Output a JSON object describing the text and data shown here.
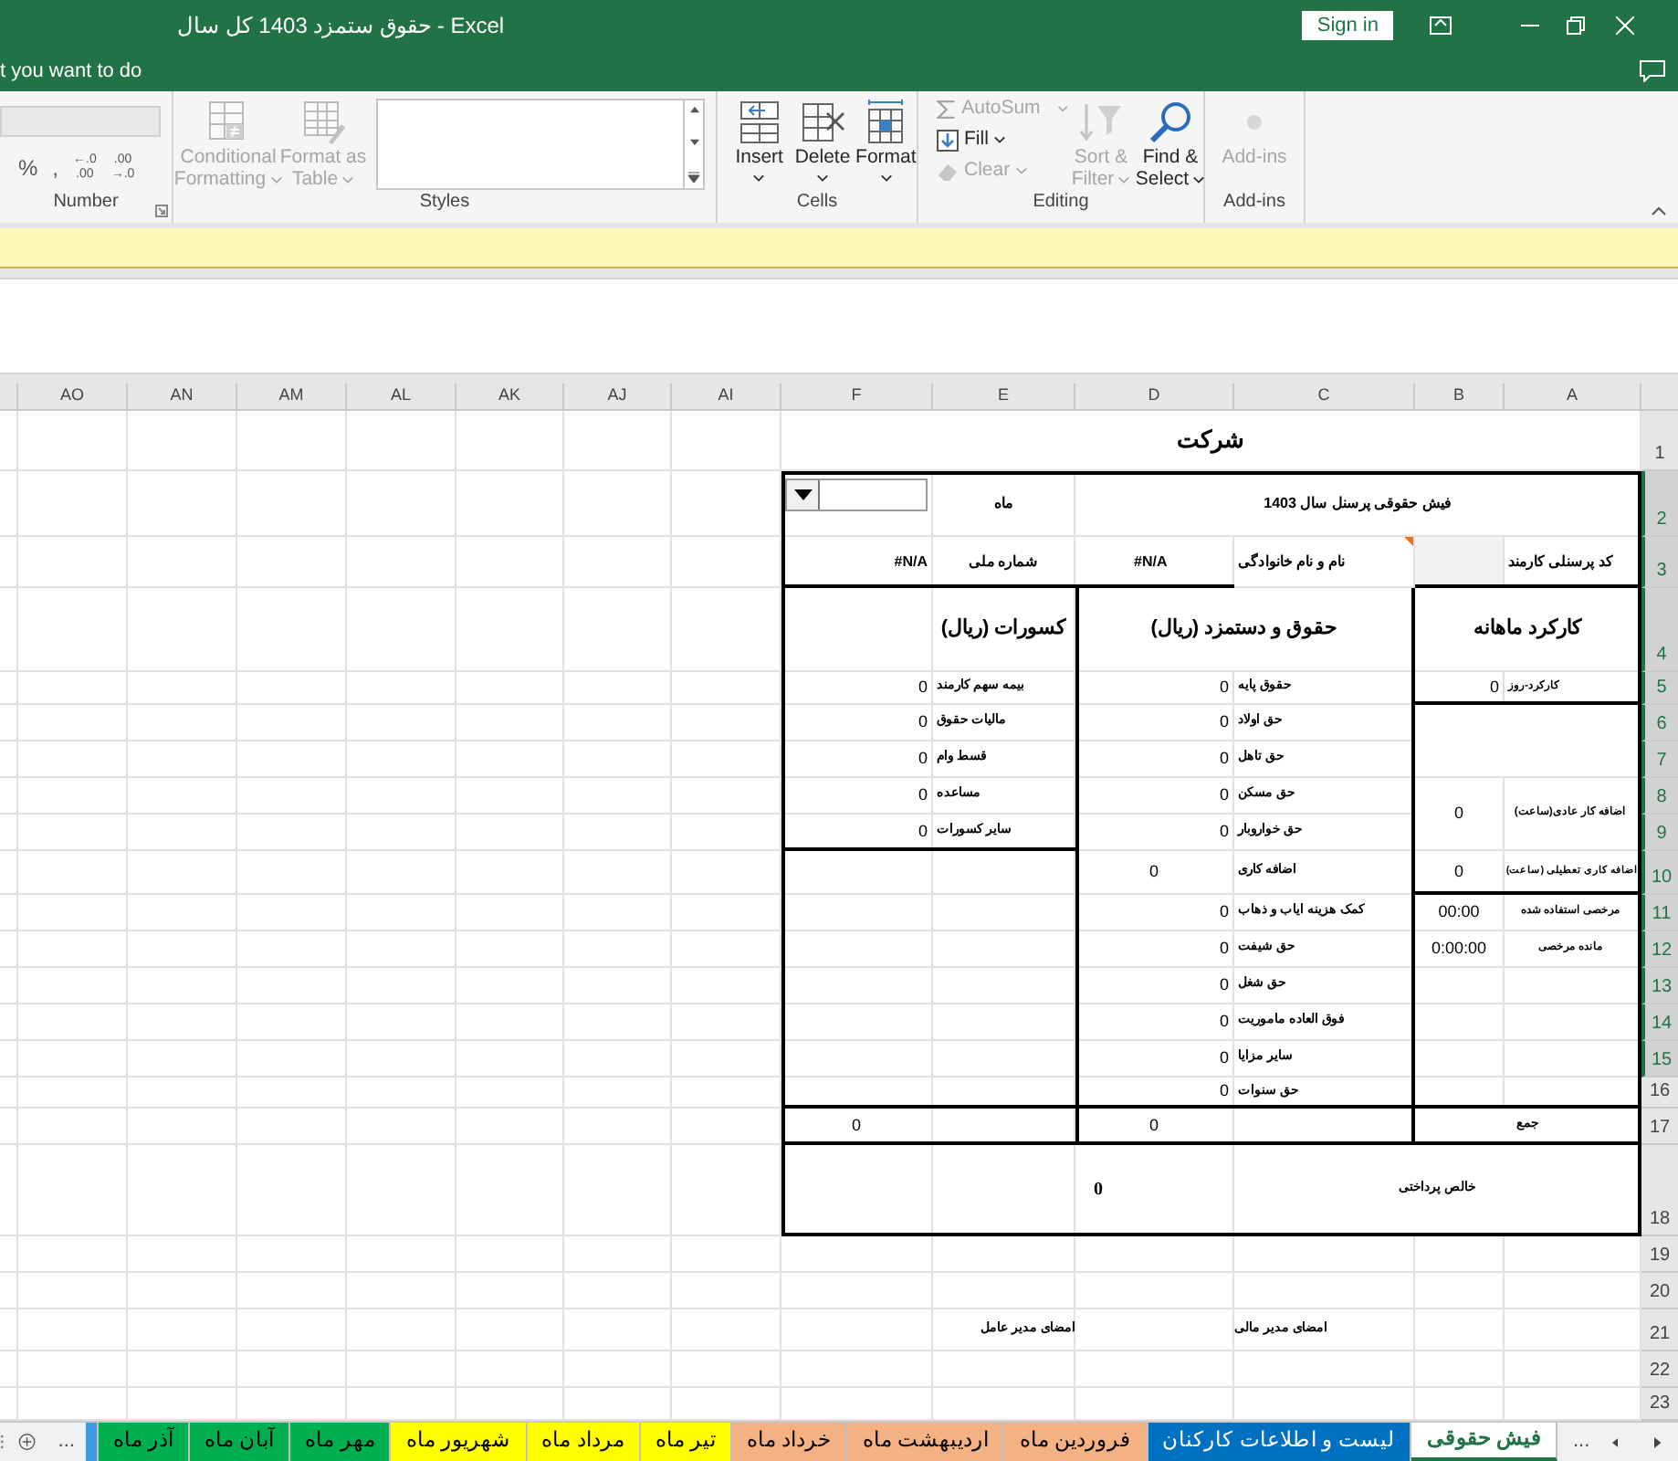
{
  "window": {
    "title": "حقوق  ستمزد 1403 کل سال  -  Excel",
    "sign_in": "Sign in"
  },
  "tell_me": {
    "text": "t you want to do"
  },
  "ribbon": {
    "number": {
      "label": "Number",
      "symbols": [
        ",",
        "%"
      ],
      "decimals": [
        {
          "top": ".00",
          "bottom": "→.0"
        },
        {
          "top": "←.0",
          "bottom": ".00"
        }
      ]
    },
    "styles": {
      "label": "Styles",
      "commands": [
        {
          "lines": [
            "Format as",
            "Table"
          ],
          "disabled": true
        },
        {
          "lines": [
            "Conditional",
            "Formatting"
          ],
          "disabled": true
        }
      ]
    },
    "cells": {
      "label": "Cells",
      "commands": [
        {
          "label": "Format",
          "disabled": false
        },
        {
          "label": "Delete",
          "disabled": false
        },
        {
          "label": "Insert",
          "disabled": false
        }
      ]
    },
    "editing": {
      "label": "Editing",
      "small": [
        {
          "label": "AutoSum",
          "disabled": true
        },
        {
          "label": "Fill",
          "disabled": false
        },
        {
          "label": "Clear",
          "disabled": true
        }
      ],
      "large": [
        {
          "lines": [
            "Find &",
            "Select"
          ],
          "disabled": false
        },
        {
          "lines": [
            "Sort &",
            "Filter"
          ],
          "disabled": true
        }
      ]
    },
    "addins": {
      "label": "Add-ins",
      "commands": [
        {
          "label": "Add-ins",
          "disabled": true
        }
      ]
    }
  },
  "columns": [
    "A",
    "B",
    "C",
    "D",
    "E",
    "F",
    "AI",
    "AJ",
    "AK",
    "AL",
    "AM",
    "AN",
    "AO"
  ],
  "rows": [
    {
      "number": "1",
      "selected": false
    },
    {
      "number": "2",
      "selected": true
    },
    {
      "number": "3",
      "selected": true
    },
    {
      "number": "4",
      "selected": true
    },
    {
      "number": "5",
      "selected": true
    },
    {
      "number": "6",
      "selected": true
    },
    {
      "number": "7",
      "selected": true
    },
    {
      "number": "8",
      "selected": true
    },
    {
      "number": "9",
      "selected": true
    },
    {
      "number": "10",
      "selected": true
    },
    {
      "number": "11",
      "selected": true
    },
    {
      "number": "12",
      "selected": true
    },
    {
      "number": "13",
      "selected": true
    },
    {
      "number": "14",
      "selected": true
    },
    {
      "number": "15",
      "selected": true
    },
    {
      "number": "16",
      "selected": false
    },
    {
      "number": "17",
      "selected": false
    },
    {
      "number": "18",
      "selected": false
    },
    {
      "number": "19",
      "selected": false
    },
    {
      "number": "20",
      "selected": false
    },
    {
      "number": "21",
      "selected": false
    },
    {
      "number": "22",
      "selected": false
    },
    {
      "number": "23",
      "selected": false
    }
  ],
  "payslip": {
    "company": "شرکت",
    "title": "فیش حقوقی  پرسنل سال 1403",
    "month_label": "ماه",
    "employee_code_label": "کد پرسنلی کارمند",
    "name_label": "نام و نام خانوادگی",
    "name_value": "#N/A",
    "national_id_label": "شماره ملی",
    "national_id_value": "#N/A",
    "sections": [
      "کارکرد ماهانه",
      "حقوق و دستمزد (ریال)",
      "کسورات (ریال)"
    ],
    "attendance": [
      {
        "label": "کارکرد-روز",
        "value": "0"
      },
      {
        "label": "اضافه کار عادی(ساعت)",
        "value": "0"
      },
      {
        "label": "اضافه کاری تعطیلی (ساعت)",
        "value": "0"
      },
      {
        "label": "مرخصی استفاده شده",
        "value": "00:00"
      },
      {
        "label": "مانده مرخصی",
        "value": "0:00:00"
      }
    ],
    "earnings": [
      {
        "label": "حقوق پایه",
        "value": "0"
      },
      {
        "label": "حق اولاد",
        "value": "0"
      },
      {
        "label": "حق تاهل",
        "value": "0"
      },
      {
        "label": "حق مسکن",
        "value": "0"
      },
      {
        "label": "حق خواروبار",
        "value": "0"
      },
      {
        "label": "اضافه کاری",
        "value": "0"
      },
      {
        "label": "کمک هزینه ایاب و ذهاب",
        "value": "0"
      },
      {
        "label": "حق شیفت",
        "value": "0"
      },
      {
        "label": "حق شغل",
        "value": "0"
      },
      {
        "label": "فوق العاده ماموریت",
        "value": "0"
      },
      {
        "label": "سایر مزایا",
        "value": "0"
      },
      {
        "label": "حق سنوات",
        "value": "0"
      }
    ],
    "deductions": [
      {
        "label": "بیمه سهم کارمند",
        "value": "0"
      },
      {
        "label": "مالیات حقوق",
        "value": "0"
      },
      {
        "label": "قسط وام",
        "value": "0"
      },
      {
        "label": "مساعده",
        "value": "0"
      },
      {
        "label": "سایر کسورات",
        "value": "0"
      }
    ],
    "total_label": "جمع",
    "earnings_total": "0",
    "deductions_total": "0",
    "net_label": "خالص پرداختی",
    "net_value": "0"
  },
  "signatures": [
    "امضای مدیر مالی",
    "امضای مدیر عامل"
  ],
  "tabs_bar": {
    "more_right": "...",
    "more_left": "..."
  },
  "sheet_tabs": [
    {
      "label": "فیش حقوقی",
      "selected": true
    },
    {
      "label": "لیست و اطلاعات  کارکنان",
      "selected": false,
      "color": "#0070c0"
    },
    {
      "label": "فروردین ماه",
      "selected": false,
      "color": "#f4b183"
    },
    {
      "label": "اردیبهشت ماه",
      "selected": false,
      "color": "#f4b183"
    },
    {
      "label": "خرداد ماه",
      "selected": false,
      "color": "#f4b183"
    },
    {
      "label": "تیر ماه",
      "selected": false,
      "color": "#ffff00"
    },
    {
      "label": "مرداد ماه",
      "selected": false,
      "color": "#ffff00"
    },
    {
      "label": "شهریور ماه",
      "selected": false,
      "color": "#ffff00"
    },
    {
      "label": "مهر ماه",
      "selected": false,
      "color": "#00b050"
    },
    {
      "label": "آبان ماه",
      "selected": false,
      "color": "#00b050"
    },
    {
      "label": "آذر ماه",
      "selected": false,
      "color": "#00b050"
    },
    {
      "selected": false,
      "color": "#3c9ce6"
    }
  ]
}
